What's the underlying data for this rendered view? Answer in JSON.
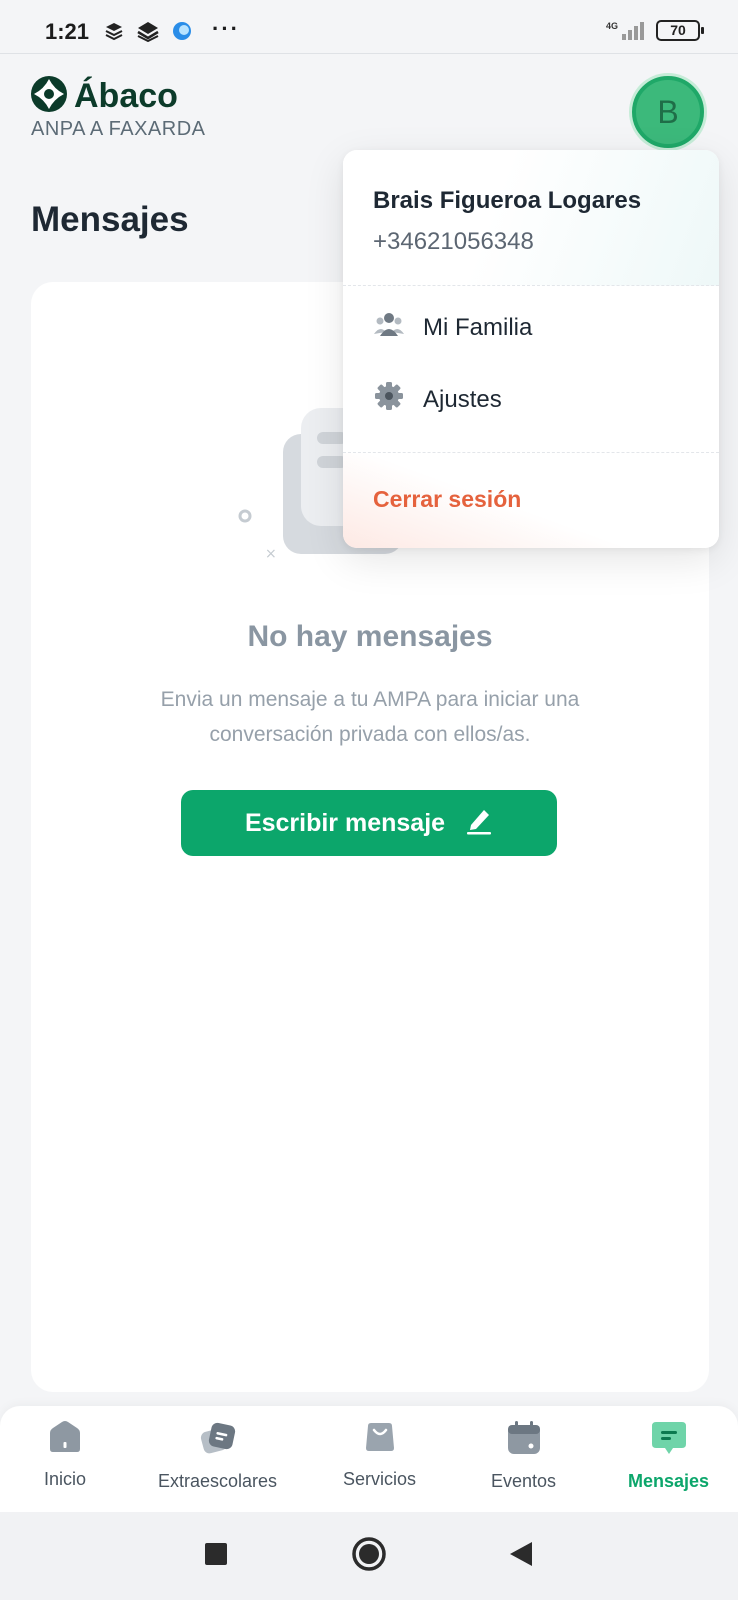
{
  "status_bar": {
    "time": "1:21",
    "more": "···",
    "network": "4G",
    "battery": "70"
  },
  "header": {
    "brand_name": "Ábaco",
    "organization": "ANPA A FAXARDA",
    "avatar_initial": "B"
  },
  "page": {
    "title": "Mensajes"
  },
  "empty_state": {
    "title": "No hay mensajes",
    "description": "Envia un mensaje a tu AMPA para iniciar una conversación privada con ellos/as.",
    "button_label": "Escribir mensaje"
  },
  "user_menu": {
    "name": "Brais Figueroa Logares",
    "phone": "+34621056348",
    "items": [
      {
        "label": "Mi Familia",
        "icon": "family-icon"
      },
      {
        "label": "Ajustes",
        "icon": "gear-icon"
      }
    ],
    "logout_label": "Cerrar sesión"
  },
  "bottom_nav": {
    "items": [
      {
        "label": "Inicio",
        "icon": "home-icon"
      },
      {
        "label": "Extraescolares",
        "icon": "activities-icon"
      },
      {
        "label": "Servicios",
        "icon": "shopping-bag-icon"
      },
      {
        "label": "Eventos",
        "icon": "calendar-icon"
      },
      {
        "label": "Mensajes",
        "icon": "message-icon"
      }
    ],
    "active": "Mensajes"
  },
  "colors": {
    "brand_green": "#0ca66b",
    "brand_dark": "#0c3b2a",
    "logout_red": "#e5623d"
  }
}
